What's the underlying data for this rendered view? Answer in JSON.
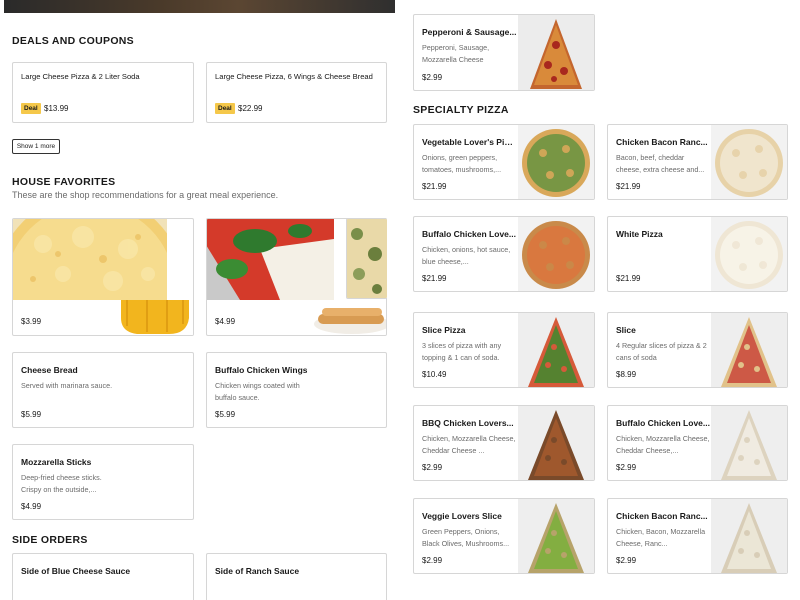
{
  "deals": {
    "title": "DEALS AND COUPONS",
    "items": [
      {
        "name": "Large Cheese Pizza & 2 Liter Soda",
        "badge": "Deal",
        "price": "$13.99"
      },
      {
        "name": "Large Cheese Pizza, 6 Wings & Cheese Bread",
        "badge": "Deal",
        "price": "$22.99"
      }
    ],
    "show_more": "Show 1 more"
  },
  "favorites": {
    "title": "HOUSE FAVORITES",
    "subtitle": "These are the shop recommendations for a great meal experience.",
    "prices": [
      "$3.99",
      "$4.99"
    ],
    "items": [
      {
        "name": "Cheese Bread",
        "desc": "Served with marinara sauce.",
        "price": "$5.99"
      },
      {
        "name": "Buffalo Chicken Wings",
        "desc": "Chicken wings coated with buffalo sauce.",
        "price": "$5.99"
      },
      {
        "name": "Mozzarella Sticks",
        "desc": "Deep-fried cheese sticks. Crispy on the outside,...",
        "price": "$4.99"
      }
    ]
  },
  "sides": {
    "title": "SIDE ORDERS",
    "items": [
      {
        "name": "Side of Blue Cheese Sauce"
      },
      {
        "name": "Side of Ranch Sauce"
      }
    ]
  },
  "top_item": {
    "name": "Pepperoni & Sausage...",
    "desc": "Pepperoni, Sausage, Mozzarella Cheese",
    "price": "$2.99"
  },
  "specialty": {
    "title": "SPECIALTY PIZZA",
    "items": [
      {
        "name": "Vegetable Lover's Pizza",
        "desc": "Onions, green peppers, tomatoes, mushrooms,...",
        "price": "$21.99"
      },
      {
        "name": "Chicken Bacon Ranc...",
        "desc": "Bacon, beef, cheddar cheese, extra cheese and...",
        "price": "$21.99"
      },
      {
        "name": "Buffalo Chicken Love...",
        "desc": "Chicken, onions, hot sauce, blue cheese,...",
        "price": "$21.99"
      },
      {
        "name": "White Pizza",
        "desc": "",
        "price": "$21.99"
      },
      {
        "name": "Slice Pizza",
        "desc": "3 slices of pizza with any topping & 1 can of soda.",
        "price": "$10.49"
      },
      {
        "name": "Slice",
        "desc": "4 Regular slices of pizza & 2 cans of soda",
        "price": "$8.99"
      },
      {
        "name": "BBQ Chicken Lovers...",
        "desc": "Chicken, Mozzarella Cheese, Cheddar Cheese ...",
        "price": "$2.99"
      },
      {
        "name": "Buffalo Chicken Love...",
        "desc": "Chicken, Mozzarella Cheese, Cheddar Cheese,...",
        "price": "$2.99"
      },
      {
        "name": "Veggie Lovers Slice",
        "desc": "Green Peppers, Onions, Black Olives, Mushrooms...",
        "price": "$2.99"
      },
      {
        "name": "Chicken Bacon Ranc...",
        "desc": "Chicken, Bacon, Mozzarella Cheese, Ranc...",
        "price": "$2.99"
      }
    ]
  },
  "colors": {
    "deal_badge": "#f5c84a",
    "text": "#191919",
    "muted": "#6b6b6b",
    "border": "#d6d6d6"
  }
}
